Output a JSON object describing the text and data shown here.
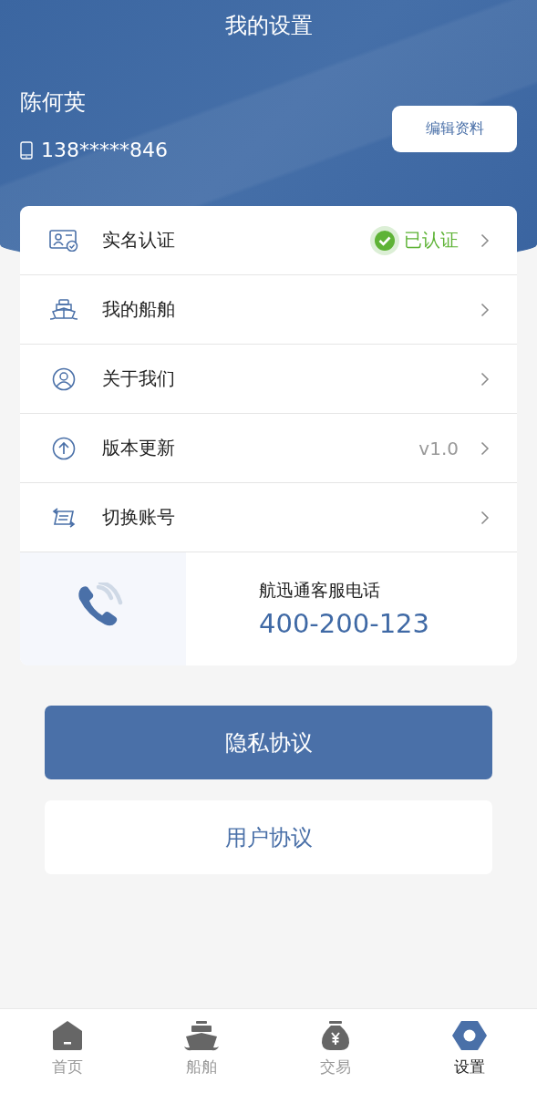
{
  "header": {
    "title": "我的设置"
  },
  "profile": {
    "name": "陈何英",
    "phone": "138*****846",
    "edit_button": "编辑资料"
  },
  "menu": [
    {
      "label": "实名认证",
      "status": "已认证",
      "verified": true
    },
    {
      "label": "我的船舶"
    },
    {
      "label": "关于我们"
    },
    {
      "label": "版本更新",
      "value": "v1.0"
    },
    {
      "label": "切换账号"
    }
  ],
  "hotline": {
    "label": "航迅通客服电话",
    "number": "400-200-123"
  },
  "buttons": [
    {
      "label": "隐私协议",
      "primary": true
    },
    {
      "label": "用户协议",
      "primary": false
    }
  ],
  "tabs": [
    {
      "label": "首页",
      "selected": false
    },
    {
      "label": "船舶",
      "selected": false
    },
    {
      "label": "交易",
      "selected": false
    },
    {
      "label": "设置",
      "selected": true
    }
  ]
}
